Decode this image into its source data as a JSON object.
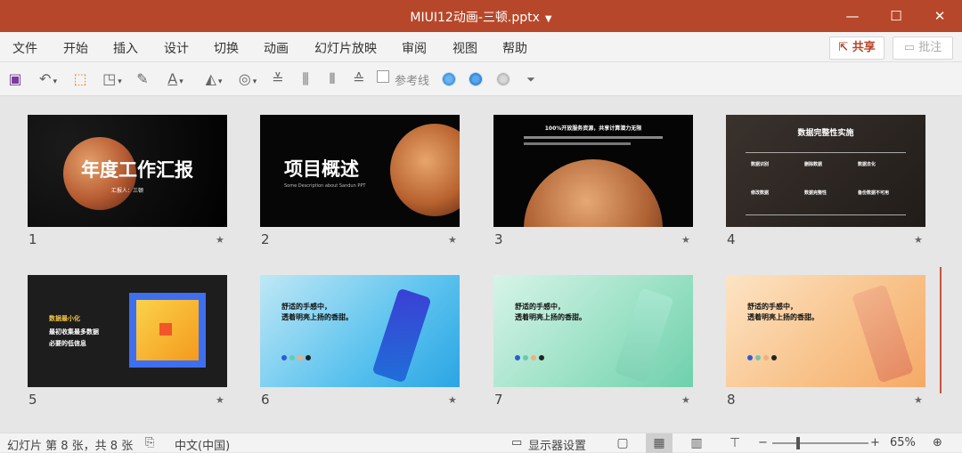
{
  "window": {
    "title": "MIUI12动画-三顿.pptx"
  },
  "menu": {
    "file": "文件",
    "home": "开始",
    "insert": "插入",
    "design": "设计",
    "transitions": "切换",
    "animations": "动画",
    "slideshow": "幻灯片放映",
    "review": "审阅",
    "view": "视图",
    "help": "帮助",
    "share": "共享",
    "comments": "批注"
  },
  "toolbar": {
    "reference_line": "参考线"
  },
  "slides": [
    {
      "number": "1",
      "title": "年度工作汇报",
      "subtitle": "汇报人：三顿"
    },
    {
      "number": "2",
      "title": "项目概述",
      "subtitle": "Some Description about Sandun PPT"
    },
    {
      "number": "3",
      "title": "100%开放服务资源，共享计算潜力无限",
      "subtitle": ""
    },
    {
      "number": "4",
      "title": "数据完整性实施",
      "items": [
        "数据识别",
        "删除数据",
        "数据去化",
        "修改数据",
        "数据完整性",
        "备份数据不可用"
      ]
    },
    {
      "number": "5",
      "title": "数据最小化",
      "subtitle": "最初收集最多数据 必要的低信息"
    },
    {
      "number": "6",
      "title": "舒适的手感中，",
      "subtitle": "透着明亮上扬的香甜。"
    },
    {
      "number": "7",
      "title": "舒适的手感中，",
      "subtitle": "透着明亮上扬的香甜。"
    },
    {
      "number": "8",
      "title": "舒适的手感中，",
      "subtitle": "透着明亮上扬的香甜。"
    }
  ],
  "status": {
    "slide_info": "幻灯片 第 8 张，共 8 张",
    "language": "中文(中国)",
    "display_settings": "显示器设置",
    "zoom": "65%"
  },
  "colors": {
    "accent": "#b7472a"
  }
}
